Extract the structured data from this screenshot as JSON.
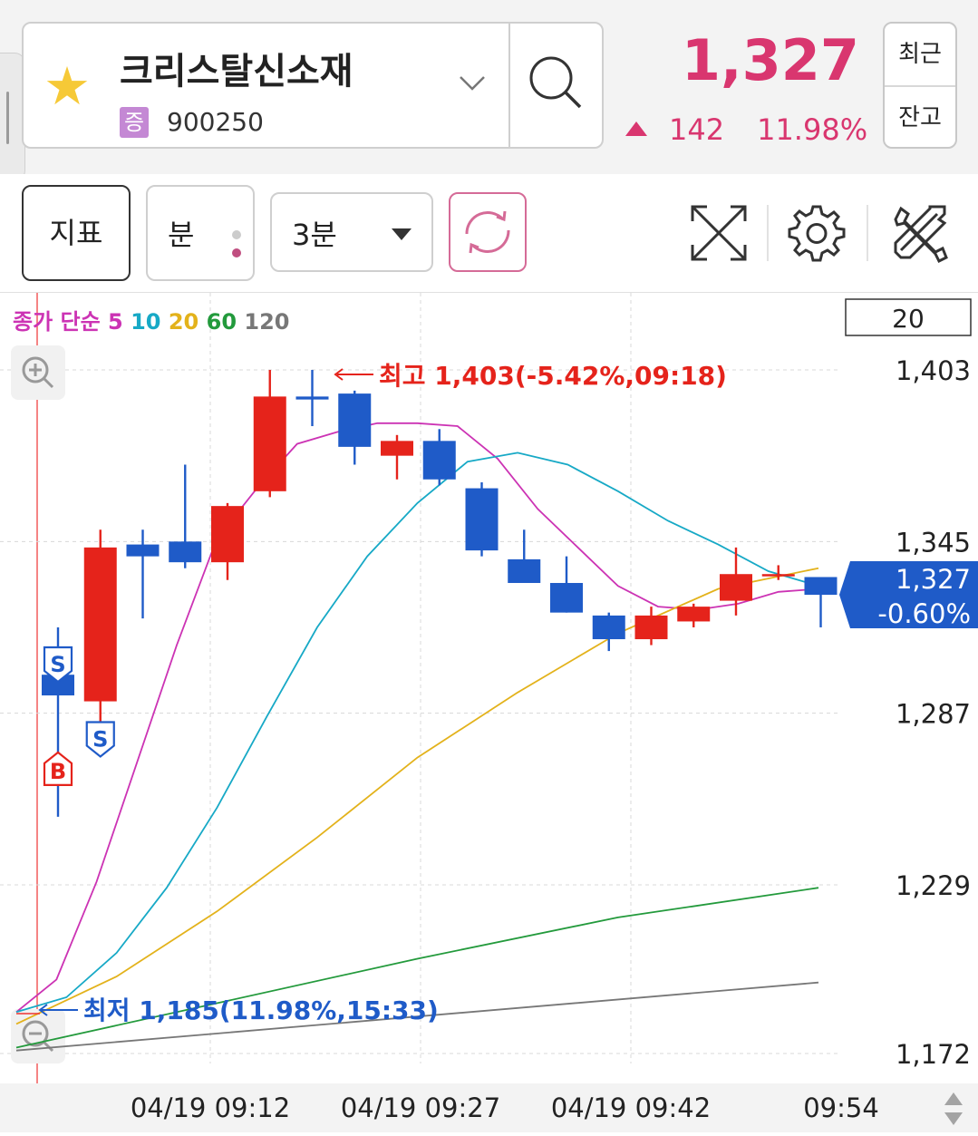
{
  "header": {
    "stock_name": "크리스탈신소재",
    "market_badge": "증",
    "stock_code": "900250",
    "price": "1,327",
    "change_amount": "142",
    "change_percent": "11.98%",
    "side_button_top": "최근",
    "side_button_bottom": "잔고",
    "price_color": "#d9366f",
    "icons": [
      "star-icon",
      "chevron-down-icon",
      "search-icon",
      "up-triangle-icon"
    ]
  },
  "toolbar": {
    "indicator_label": "지표",
    "unit_label": "분",
    "interval_label": "3분",
    "icons": [
      "refresh-icon",
      "expand-icon",
      "gear-icon",
      "tools-icon",
      "up-down-icon"
    ]
  },
  "chart_data": {
    "type": "candlestick",
    "ma_label_prefix": "종가 단순",
    "period_box": "20",
    "price_tag": {
      "value": "1,327",
      "percent": "-0.60%"
    },
    "high_annotation": "최고 1,403(-5.42%,09:18)",
    "low_annotation": "최저 1,185(11.98%,15:33)",
    "y_ticks": [
      "1,403",
      "1,345",
      "1,287",
      "1,229",
      "1,172"
    ],
    "y_tick_values": [
      1403,
      1345,
      1287,
      1229,
      1172
    ],
    "x_ticks": [
      "04/19 09:12",
      "04/19 09:27",
      "04/19 09:42",
      "09:54"
    ],
    "ylim": [
      1165,
      1410
    ],
    "markers": [
      {
        "label": "S",
        "candle": 0,
        "type": "sell"
      },
      {
        "label": "B",
        "candle": 0,
        "type": "buy"
      },
      {
        "label": "S",
        "candle": 1,
        "type": "sell"
      }
    ],
    "candles": [
      {
        "open": 1300,
        "close": 1293,
        "high": 1316,
        "low": 1252
      },
      {
        "open": 1291,
        "close": 1343,
        "high": 1349,
        "low": 1280
      },
      {
        "open": 1344,
        "close": 1340,
        "high": 1349,
        "low": 1319
      },
      {
        "open": 1345,
        "close": 1338,
        "high": 1371,
        "low": 1336
      },
      {
        "open": 1338,
        "close": 1357,
        "high": 1358,
        "low": 1332
      },
      {
        "open": 1362,
        "close": 1394,
        "high": 1403,
        "low": 1360
      },
      {
        "open": 1394,
        "close": 1393,
        "high": 1403,
        "low": 1384
      },
      {
        "open": 1395,
        "close": 1377,
        "high": 1396,
        "low": 1371
      },
      {
        "open": 1374,
        "close": 1379,
        "high": 1381,
        "low": 1366
      },
      {
        "open": 1379,
        "close": 1366,
        "high": 1383,
        "low": 1364
      },
      {
        "open": 1363,
        "close": 1342,
        "high": 1365,
        "low": 1340
      },
      {
        "open": 1339,
        "close": 1331,
        "high": 1349,
        "low": 1331
      },
      {
        "open": 1331,
        "close": 1321,
        "high": 1340,
        "low": 1321
      },
      {
        "open": 1320,
        "close": 1312,
        "high": 1321,
        "low": 1308
      },
      {
        "open": 1312,
        "close": 1320,
        "high": 1323,
        "low": 1310
      },
      {
        "open": 1318,
        "close": 1323,
        "high": 1324,
        "low": 1316
      },
      {
        "open": 1325,
        "close": 1334,
        "high": 1343,
        "low": 1320
      },
      {
        "open": 1334,
        "close": 1334,
        "high": 1337,
        "low": 1332
      },
      {
        "open": 1333,
        "close": 1327,
        "high": 1333,
        "low": 1316
      }
    ],
    "series": [
      {
        "name": "5",
        "color": "#cc33b4",
        "values": [
          1186,
          1197,
          1230,
          1270,
          1310,
          1346,
          1363,
          1378,
          1382,
          1385,
          1385,
          1384,
          1373,
          1356,
          1343,
          1330,
          1323,
          1322,
          1324,
          1328,
          1329
        ]
      },
      {
        "name": "10",
        "color": "#17a9c6",
        "values": [
          1186,
          1191,
          1206,
          1228,
          1255,
          1286,
          1316,
          1340,
          1358,
          1372,
          1375,
          1371,
          1362,
          1352,
          1344,
          1335,
          1330
        ]
      },
      {
        "name": "20",
        "color": "#e3b21b",
        "values": [
          1182,
          1198,
          1220,
          1245,
          1272,
          1294,
          1314,
          1329,
          1336
        ]
      },
      {
        "name": "60",
        "color": "#239a3c",
        "values": [
          1174,
          1189,
          1204,
          1218,
          1228
        ]
      },
      {
        "name": "120",
        "color": "#777777",
        "values": [
          1173,
          1196
        ]
      }
    ]
  }
}
